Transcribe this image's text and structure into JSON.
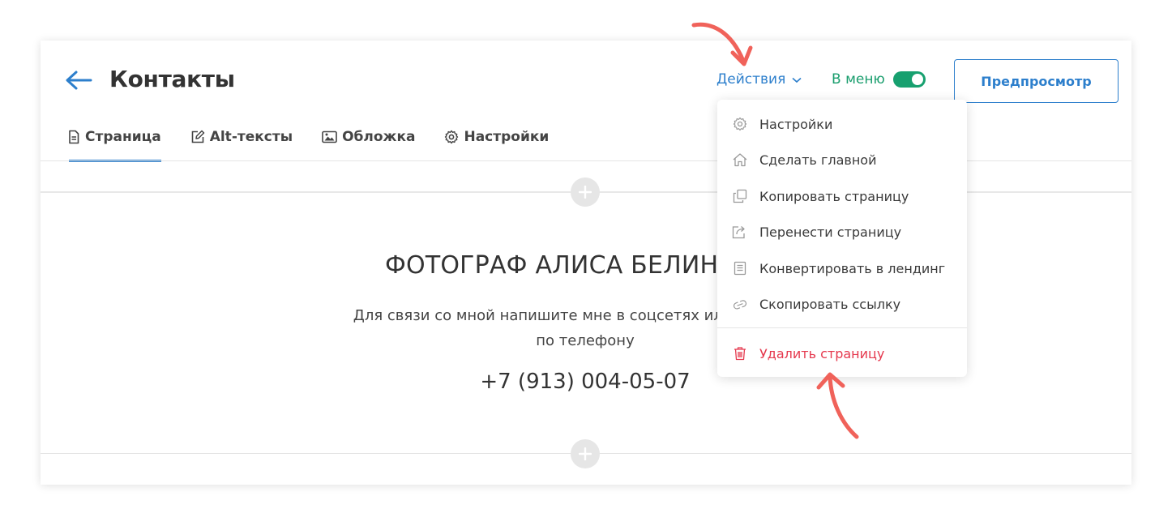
{
  "header": {
    "title": "Контакты",
    "actions_label": "Действия",
    "menu_toggle_label": "В меню",
    "menu_toggle_on": true,
    "preview_label": "Предпросмотр"
  },
  "tabs": [
    {
      "label": "Страница",
      "icon": "document-icon",
      "active": true
    },
    {
      "label": "Alt-тексты",
      "icon": "pencil-icon",
      "active": false
    },
    {
      "label": "Обложка",
      "icon": "image-icon",
      "active": false
    },
    {
      "label": "Настройки",
      "icon": "gear-icon",
      "active": false
    }
  ],
  "content": {
    "title": "ФОТОГРАФ АЛИСА БЕЛИНСКАЯ",
    "text": "Для связи со мной напишите мне в соцсетях или позвоните по телефону",
    "phone": "+7 (913) 004-05-07"
  },
  "dropdown": {
    "items": [
      {
        "label": "Настройки",
        "icon": "gear-icon"
      },
      {
        "label": "Сделать главной",
        "icon": "home-icon"
      },
      {
        "label": "Копировать страницу",
        "icon": "copy-icon"
      },
      {
        "label": "Перенести страницу",
        "icon": "share-icon"
      },
      {
        "label": "Конвертировать в лендинг",
        "icon": "document-icon"
      },
      {
        "label": "Скопировать ссылку",
        "icon": "link-icon"
      }
    ],
    "danger_item": {
      "label": "Удалить страницу",
      "icon": "trash-icon"
    }
  },
  "colors": {
    "accent": "#2d7fcc",
    "toggle": "#17a06f",
    "danger": "#e5384d",
    "annotation": "#f0625a"
  }
}
